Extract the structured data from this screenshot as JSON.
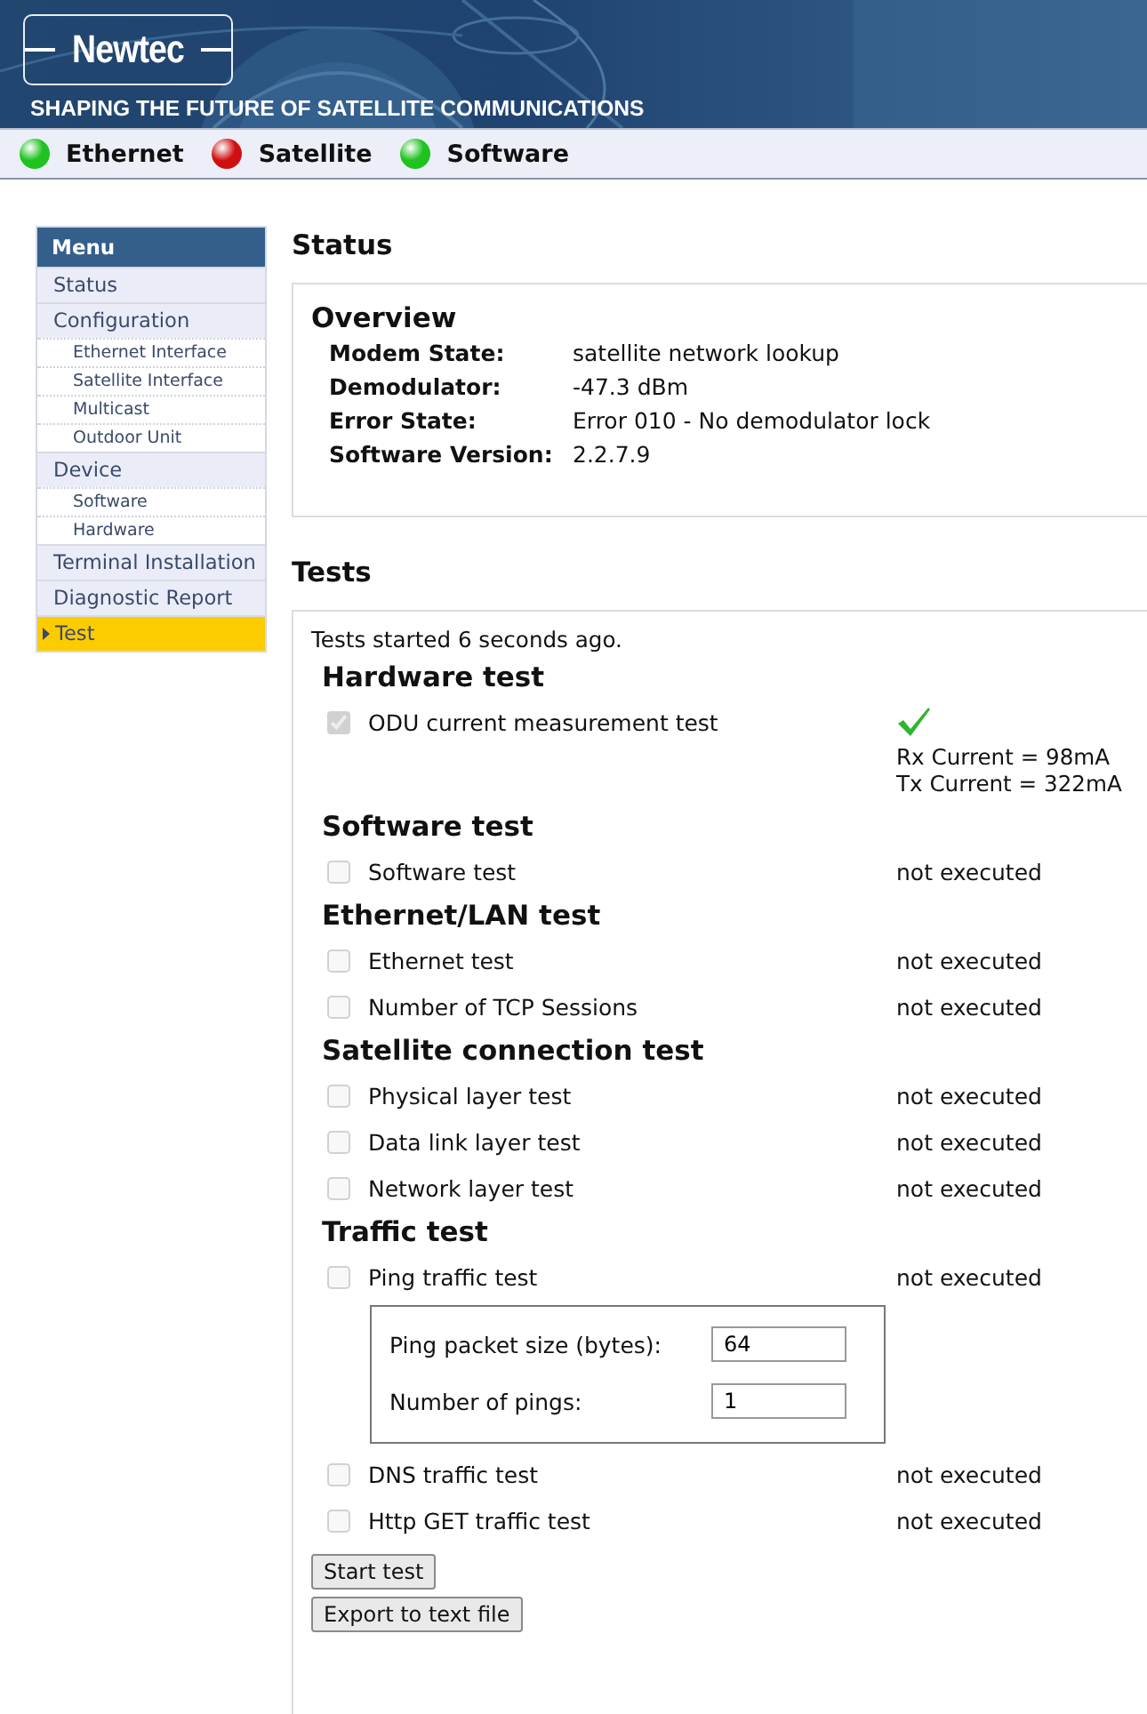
{
  "header": {
    "logo": "Newtec",
    "tagline": "SHAPING THE FUTURE OF SATELLITE COMMUNICATIONS"
  },
  "indicators": [
    {
      "label": "Ethernet",
      "color": "#1fc21f"
    },
    {
      "label": "Satellite",
      "color": "#d01010"
    },
    {
      "label": "Software",
      "color": "#1fc21f"
    }
  ],
  "menu": {
    "title": "Menu",
    "items": [
      {
        "label": "Status",
        "kind": "main",
        "selected": false
      },
      {
        "label": "Configuration",
        "kind": "main",
        "selected": false
      },
      {
        "label": "Ethernet Interface",
        "kind": "sub",
        "selected": false
      },
      {
        "label": "Satellite Interface",
        "kind": "sub",
        "selected": false
      },
      {
        "label": "Multicast",
        "kind": "sub",
        "selected": false
      },
      {
        "label": "Outdoor Unit",
        "kind": "sub",
        "selected": false
      },
      {
        "label": "Device",
        "kind": "main",
        "selected": false
      },
      {
        "label": "Software",
        "kind": "sub",
        "selected": false
      },
      {
        "label": "Hardware",
        "kind": "sub",
        "selected": false
      },
      {
        "label": "Terminal Installation",
        "kind": "main",
        "selected": false
      },
      {
        "label": "Diagnostic Report",
        "kind": "main",
        "selected": false
      },
      {
        "label": "Test",
        "kind": "main",
        "selected": true
      }
    ]
  },
  "status": {
    "heading": "Status",
    "overview": {
      "title": "Overview",
      "rows": [
        {
          "label": "Modem State:",
          "value": "satellite network lookup"
        },
        {
          "label": "Demodulator:",
          "value": "-47.3 dBm"
        },
        {
          "label": "Error State:",
          "value": "Error 010 - No demodulator lock"
        },
        {
          "label": "Software Version:",
          "value": "2.2.7.9"
        }
      ]
    }
  },
  "tests": {
    "heading": "Tests",
    "started": "Tests started 6 seconds ago.",
    "groups": [
      {
        "title": "Hardware test",
        "tests": [
          {
            "label": "ODU current measurement test",
            "checked": true,
            "kind": "passed",
            "details": [
              "Rx Current = 98mA",
              "Tx Current = 322mA"
            ]
          }
        ]
      },
      {
        "title": "Software test",
        "tests": [
          {
            "label": "Software test",
            "checked": false,
            "kind": "text",
            "result": "not executed"
          }
        ]
      },
      {
        "title": "Ethernet/LAN test",
        "tests": [
          {
            "label": "Ethernet test",
            "checked": false,
            "kind": "text",
            "result": "not executed"
          },
          {
            "label": "Number of TCP Sessions",
            "checked": false,
            "kind": "text",
            "result": "not executed"
          }
        ]
      },
      {
        "title": "Satellite connection test",
        "tests": [
          {
            "label": "Physical layer test",
            "checked": false,
            "kind": "text",
            "result": "not executed"
          },
          {
            "label": "Data link layer test",
            "checked": false,
            "kind": "text",
            "result": "not executed"
          },
          {
            "label": "Network layer test",
            "checked": false,
            "kind": "text",
            "result": "not executed"
          }
        ]
      },
      {
        "title": "Traffic test",
        "tests": [
          {
            "label": "Ping traffic test",
            "checked": false,
            "kind": "text",
            "result": "not executed",
            "params": [
              {
                "label": "Ping packet size (bytes):",
                "value": "64"
              },
              {
                "label": "Number of pings:",
                "value": "1"
              }
            ]
          },
          {
            "label": "DNS traffic test",
            "checked": false,
            "kind": "text",
            "result": "not executed"
          },
          {
            "label": "Http GET traffic test",
            "checked": false,
            "kind": "text",
            "result": "not executed"
          }
        ]
      }
    ],
    "buttons": [
      "Start test",
      "Export to text file"
    ]
  }
}
